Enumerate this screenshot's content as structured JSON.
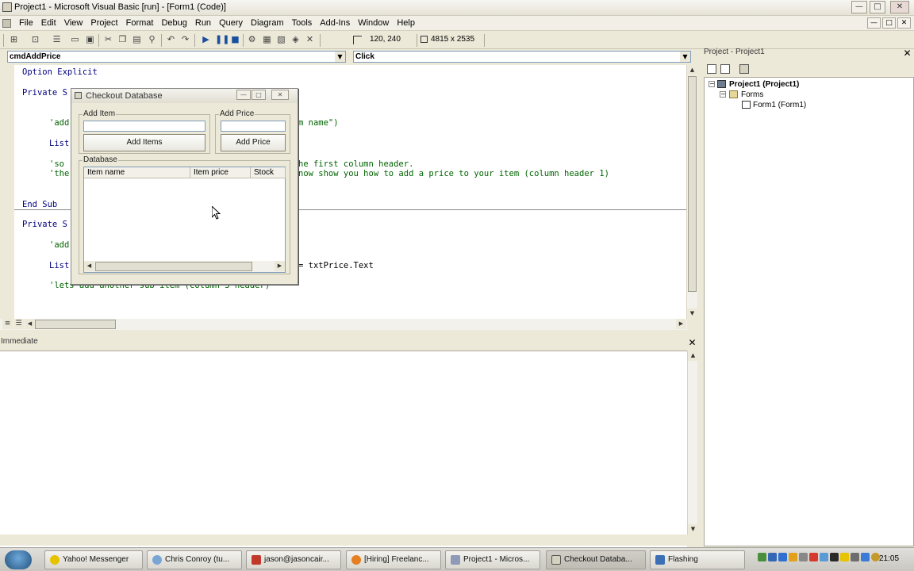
{
  "window": {
    "title": "Project1 - Microsoft Visual Basic [run] - [Form1 (Code)]",
    "min_label": "—",
    "max_label": "□",
    "close_label": "✕"
  },
  "menu": {
    "items": [
      "File",
      "Edit",
      "View",
      "Project",
      "Format",
      "Debug",
      "Run",
      "Query",
      "Diagram",
      "Tools",
      "Add-Ins",
      "Window",
      "Help"
    ]
  },
  "toolbar": {
    "position_text": "120, 240",
    "size_text": "4815 x 2535"
  },
  "code": {
    "object_dropdown": "cmdAddPrice",
    "procedure_dropdown": "Click",
    "lines": {
      "option_explicit": "Option Explicit",
      "private_sub_1": "Private S",
      "add_comment_1": "'add",
      "add_comment_1_tail": "m name\")",
      "list_1": "List",
      "so_comment": "'so",
      "so_comment_tail": "he first column header.",
      "the_comment": "'the",
      "the_comment_tail": "now show you how to add a price to your item (column header 1)",
      "end_sub": "End Sub",
      "private_sub_2": "Private S",
      "add_comment_2": "'add",
      "list_2": "List",
      "list_2_tail": "= txtPrice.Text",
      "lets_comment": "'lets add another sub item (column 3 header)"
    }
  },
  "project_panel": {
    "title": "Project - Project1",
    "tree": {
      "project": "Project1 (Project1)",
      "forms": "Forms",
      "form1": "Form1 (Form1)"
    }
  },
  "immediate": {
    "title": "Immediate"
  },
  "form": {
    "title": "Checkout Database",
    "add_item_group": "Add Item",
    "add_price_group": "Add Price",
    "add_items_button": "Add Items",
    "add_price_button": "Add Price",
    "database_group": "Database",
    "columns": [
      "Item name",
      "Item price",
      "Stock"
    ]
  },
  "taskbar": {
    "tasks": [
      "Yahoo! Messenger",
      "Chris Conroy (tu...",
      "jason@jasoncair...",
      "[Hiring] Freelanc...",
      "Project1 - Micros...",
      "Checkout Databa...",
      "Flashing"
    ],
    "clock": "21:05"
  },
  "colors": {
    "code_keyword": "#00007f",
    "code_comment": "#006400",
    "chrome": "#ece9d8"
  }
}
